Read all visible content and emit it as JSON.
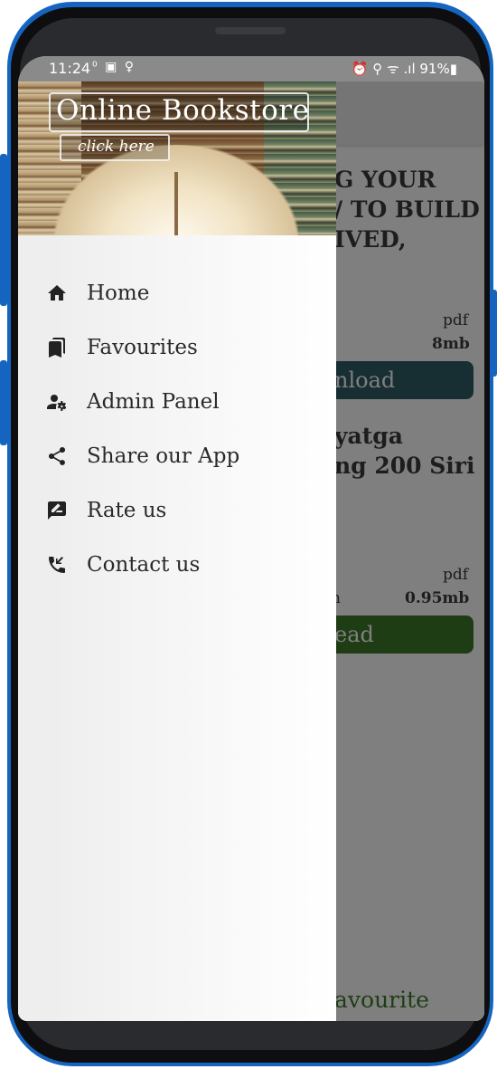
{
  "status_bar": {
    "time": "11:24",
    "left_icons": "⁰ ▣ ♀",
    "right_text": "⏰ ⚲ ᯤ .ıl 91%▮"
  },
  "drawer": {
    "header": {
      "title": "Online Bookstore",
      "click_label": "click here"
    },
    "menu": [
      {
        "label": "Home",
        "icon": "home-icon"
      },
      {
        "label": "Favourites",
        "icon": "bookmarks-icon"
      },
      {
        "label": "Admin Panel",
        "icon": "admin-settings-icon"
      },
      {
        "label": "Share our App",
        "icon": "share-icon"
      },
      {
        "label": "Rate us",
        "icon": "rate-review-icon"
      },
      {
        "label": "Contact us",
        "icon": "phone-callback-icon"
      }
    ]
  },
  "background": {
    "title_lines": [
      "G YOUR",
      "/ TO BUILD",
      "IVED,"
    ],
    "item1": {
      "format": "pdf",
      "size": "8mb",
      "button": "nload",
      "button_color": "#2e5e66"
    },
    "item2": {
      "title_lines": [
        "yatga",
        "ng 200 Siri"
      ],
      "format": "pdf",
      "size": "0.95mb",
      "left_char": "n",
      "button": "ead",
      "button_color": "#3f7a2a"
    },
    "bottom_text": "avourite",
    "bottom_color": "#3f7a2a"
  }
}
